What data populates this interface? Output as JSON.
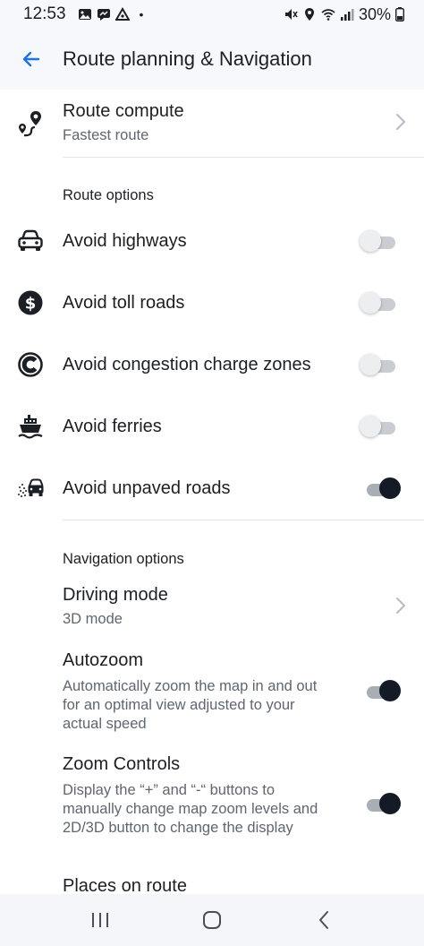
{
  "status": {
    "time": "12:53",
    "dot": "•",
    "battery_pct": "30%",
    "icons_left": [
      "gallery-icon",
      "message-icon",
      "drive-icon"
    ],
    "icons_right": [
      "mute-icon",
      "location-icon",
      "wifi-icon",
      "signal-icon",
      "battery-icon"
    ]
  },
  "appbar": {
    "title": "Route planning & Navigation",
    "back_icon": "arrow-left-icon",
    "accent": "#1a73e8"
  },
  "route_compute": {
    "label": "Route compute",
    "value": "Fastest route",
    "icon": "route-pins-icon"
  },
  "route_options": {
    "header": "Route options",
    "items": [
      {
        "label": "Avoid highways",
        "icon": "car-icon",
        "on": false
      },
      {
        "label": "Avoid toll roads",
        "icon": "dollar-icon",
        "on": false
      },
      {
        "label": "Avoid congestion charge zones",
        "icon": "congestion-icon",
        "on": false
      },
      {
        "label": "Avoid ferries",
        "icon": "ferry-icon",
        "on": false
      },
      {
        "label": "Avoid unpaved roads",
        "icon": "unpaved-icon",
        "on": true
      }
    ]
  },
  "navigation_options": {
    "header": "Navigation options",
    "driving_mode": {
      "label": "Driving mode",
      "value": "3D mode"
    },
    "autozoom": {
      "label": "Autozoom",
      "description": "Automatically zoom the map in and out for an optimal view adjusted to your actual speed",
      "on": true
    },
    "zoom_controls": {
      "label": "Zoom Controls",
      "description": "Display the “+” and “-“ buttons to manually change map zoom levels and 2D/3D button to change the display",
      "on": true
    },
    "places_on_route": {
      "label": "Places on route"
    }
  },
  "navbar": {
    "icons": [
      "recents-icon",
      "home-icon",
      "back-icon"
    ]
  },
  "colors": {
    "toggle_on": "#141b26",
    "toggle_off": "#eceef0",
    "secondary_text": "#5f6670"
  }
}
